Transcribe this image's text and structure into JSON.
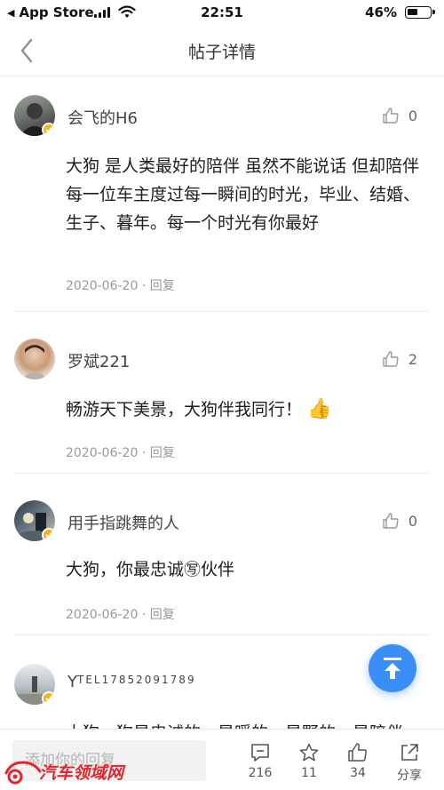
{
  "status_bar": {
    "back_app_label": "App Store",
    "time": "22:51",
    "battery_percent": "46%",
    "battery_level": 0.46
  },
  "nav": {
    "title": "帖子详情",
    "back_icon": "chevron-left-icon"
  },
  "comments": [
    {
      "username": "会飞的H6",
      "likes": "0",
      "text": "大狗 是人类最好的陪伴  虽然不能说话  但却陪伴每一位车主度过每一瞬间的时光，毕业、结婚、生子、暮年。每一个时光有你最好",
      "date": "2020-06-20",
      "reply_label": "回复"
    },
    {
      "username": "罗斌221",
      "likes": "2",
      "text": "畅游天下美景，大狗伴我同行！",
      "emoji": "👍",
      "date": "2020-06-20",
      "reply_label": "回复"
    },
    {
      "username": "用手指跳舞的人",
      "likes": "0",
      "text": "大狗，你最忠诚㊢伙伴",
      "date": "2020-06-20",
      "reply_label": "回复"
    },
    {
      "username": "Y",
      "username_suffix": "TEL17852091789",
      "text": "大狗，狗是忠诚的，是暖的，是野的，是陪伴"
    }
  ],
  "bottom_bar": {
    "reply_placeholder": "添加你的回复",
    "comments_count": "216",
    "favorites_count": "11",
    "likes_count": "34",
    "share_label": "分享"
  },
  "watermark": {
    "text": "汽车领域网"
  },
  "colors": {
    "accent_blue": "#3a8ef5",
    "badge_gold": "#f2b418",
    "watermark_red": "#e5242b"
  }
}
